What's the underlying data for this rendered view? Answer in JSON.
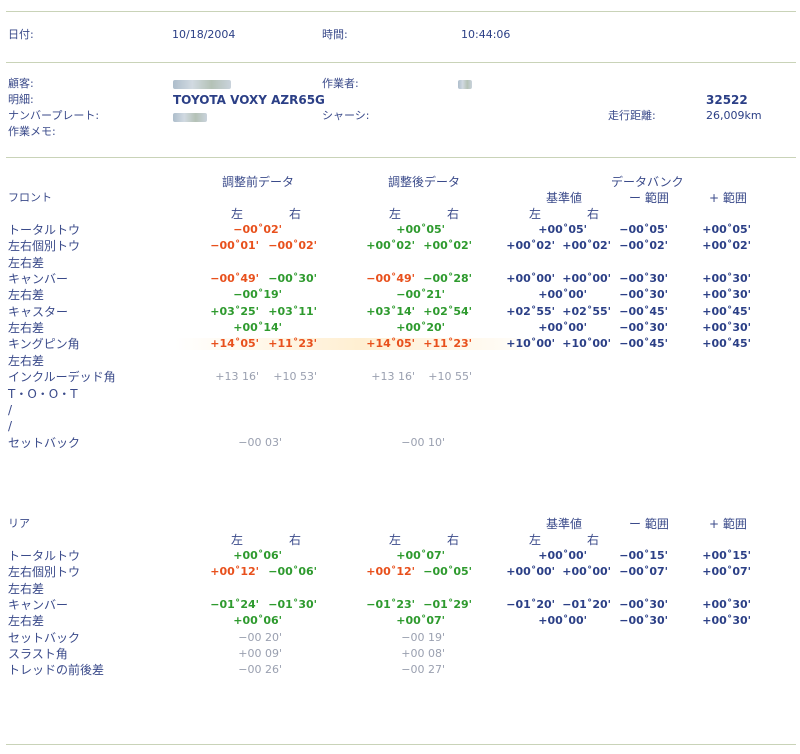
{
  "header": {
    "date_label": "日付:",
    "date_value": "10/18/2004",
    "time_label": "時間:",
    "time_value": "10:44:06",
    "customer_label": "顧客:",
    "operator_label": "作業者:",
    "detail_label": "明細:",
    "vehicle": "TOYOTA VOXY AZR65G",
    "vehicle_code": "32522",
    "plate_label": "ナンバープレート:",
    "chassis_label": "シャーシ:",
    "mileage_label": "走行距離:",
    "mileage_value": "26,009km",
    "memo_label": "作業メモ:"
  },
  "columns": {
    "before": "調整前データ",
    "after": "調整後データ",
    "databank": "データバンク",
    "reference": "基準値",
    "minus_range": "ー 範囲",
    "plus_range": "+ 範囲",
    "left": "左",
    "right": "右"
  },
  "front": {
    "title": "フロント",
    "rows": [
      {
        "label": "トータルトウ",
        "b_mid": "−00˚02'",
        "a_mid": "+00˚05'",
        "ref_mid": "+00˚05'",
        "minus": "−00˚05'",
        "plus": "+00˚05'"
      },
      {
        "label": "左右個別トウ",
        "b_l": "−00˚01'",
        "b_r": "−00˚02'",
        "a_l": "+00˚02'",
        "a_r": "+00˚02'",
        "ref_l": "+00˚02'",
        "ref_r": "+00˚02'",
        "minus": "−00˚02'",
        "plus": "+00˚02'"
      },
      {
        "label": "左右差"
      },
      {
        "label": "キャンバー",
        "b_l": "−00˚49'",
        "b_r": "−00˚30'",
        "a_l": "−00˚49'",
        "a_r": "−00˚28'",
        "ref_l": "+00˚00'",
        "ref_r": "+00˚00'",
        "minus": "−00˚30'",
        "plus": "+00˚30'"
      },
      {
        "label": "左右差",
        "b_mid": "−00˚19'",
        "a_mid": "−00˚21'",
        "ref_mid": "+00˚00'",
        "minus": "−00˚30'",
        "plus": "+00˚30'"
      },
      {
        "label": "キャスター",
        "b_l": "+03˚25'",
        "b_r": "+03˚11'",
        "a_l": "+03˚14'",
        "a_r": "+02˚54'",
        "ref_l": "+02˚55'",
        "ref_r": "+02˚55'",
        "minus": "−00˚45'",
        "plus": "+00˚45'"
      },
      {
        "label": "左右差",
        "b_mid": "+00˚14'",
        "a_mid": "+00˚20'",
        "ref_mid": "+00˚00'",
        "minus": "−00˚30'",
        "plus": "+00˚30'"
      },
      {
        "label": "キングピン角",
        "b_l": "+14˚05'",
        "b_r": "+11˚23'",
        "a_l": "+14˚05'",
        "a_r": "+11˚23'",
        "ref_l": "+10˚00'",
        "ref_r": "+10˚00'",
        "minus": "−00˚45'",
        "plus": "+00˚45'"
      },
      {
        "label": "左右差"
      },
      {
        "label": "インクルーデッド角",
        "b_l": "+13 16'",
        "b_r": "+10 53'",
        "a_l": "+13 16'",
        "a_r": "+10 55'"
      },
      {
        "label": "T・O・O・T"
      },
      {
        "label": "/"
      },
      {
        "label": "/"
      },
      {
        "label": "セットバック",
        "b_mid": "−00 03'",
        "a_mid": "−00 10'"
      }
    ]
  },
  "rear": {
    "title": "リア",
    "rows": [
      {
        "label": "トータルトウ",
        "b_mid": "+00˚06'",
        "a_mid": "+00˚07'",
        "ref_mid": "+00˚00'",
        "minus": "−00˚15'",
        "plus": "+00˚15'"
      },
      {
        "label": "左右個別トウ",
        "b_l": "+00˚12'",
        "b_r": "−00˚06'",
        "a_l": "+00˚12'",
        "a_r": "−00˚05'",
        "ref_l": "+00˚00'",
        "ref_r": "+00˚00'",
        "minus": "−00˚07'",
        "plus": "+00˚07'"
      },
      {
        "label": "左右差"
      },
      {
        "label": "キャンバー",
        "b_l": "−01˚24'",
        "b_r": "−01˚30'",
        "a_l": "−01˚23'",
        "a_r": "−01˚29'",
        "ref_l": "−01˚20'",
        "ref_r": "−01˚20'",
        "minus": "−00˚30'",
        "plus": "+00˚30'"
      },
      {
        "label": "左右差",
        "b_mid": "+00˚06'",
        "a_mid": "+00˚07'",
        "ref_mid": "+00˚00'",
        "minus": "−00˚30'",
        "plus": "+00˚30'"
      },
      {
        "label": "セットバック",
        "b_mid": "−00 20'",
        "a_mid": "−00 19'"
      },
      {
        "label": "スラスト角",
        "b_mid": "+00 09'",
        "a_mid": "+00 08'"
      },
      {
        "label": "トレッドの前後差",
        "b_mid": "−00 26'",
        "a_mid": "−00 27'"
      }
    ]
  },
  "colors": {
    "out_of_range": "#e8501c",
    "in_range": "#2e9a2e",
    "reference": "#2b3f86",
    "measured_only": "#9aa0b0"
  }
}
